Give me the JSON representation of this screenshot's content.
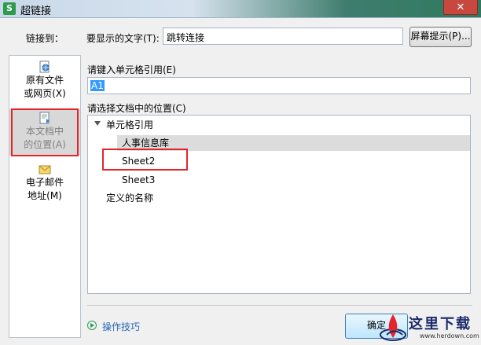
{
  "window": {
    "title": "超链接",
    "app_icon_letter": "S",
    "close_glyph": "✕"
  },
  "link_to": {
    "label": "链接到："
  },
  "display_text": {
    "label": "要显示的文字(T):",
    "value": "跳转连接"
  },
  "screentip_button": {
    "label": "屏幕提示(P)..."
  },
  "sidebar": {
    "items": [
      {
        "line1": "原有文件",
        "line2": "或网页(X)",
        "selected": false
      },
      {
        "line1": "本文档中",
        "line2": "的位置(A)",
        "selected": true
      },
      {
        "line1": "电子邮件",
        "line2": "地址(M)",
        "selected": false
      }
    ]
  },
  "cell_ref": {
    "label": "请键入单元格引用(E)",
    "value": "A1"
  },
  "place": {
    "label": "请选择文档中的位置(C)",
    "tree": [
      {
        "label": "单元格引用",
        "expanded": true
      },
      {
        "label": "人事信息库",
        "highlighted": true
      },
      {
        "label": "Sheet2"
      },
      {
        "label": "Sheet3"
      },
      {
        "label": "定义的名称"
      }
    ]
  },
  "tips": {
    "label": "操作技巧"
  },
  "ok_button": {
    "label": "确定"
  },
  "watermark": {
    "title": "这里下载",
    "url": "www.herdown.com"
  },
  "colors": {
    "highlight_box": "#e3252b",
    "accent": "#2d9a4e",
    "link": "#2768b3"
  }
}
